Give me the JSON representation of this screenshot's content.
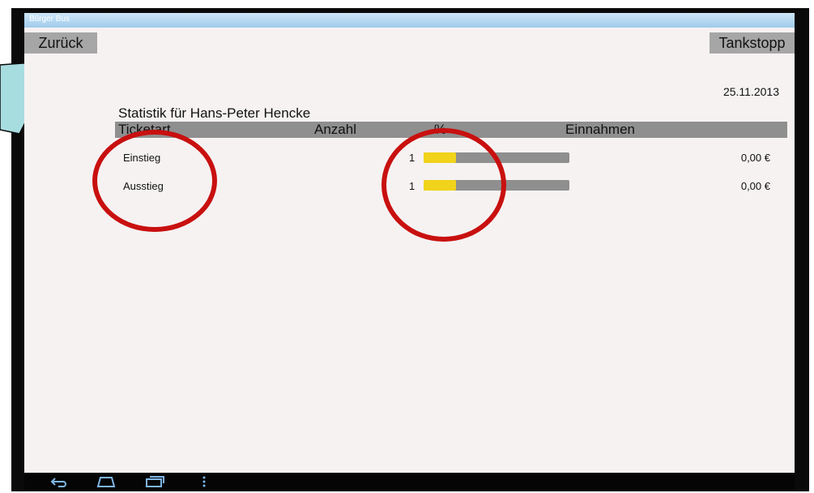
{
  "app": {
    "title": "Bürger Bus"
  },
  "toolbar": {
    "back_label": "Zurück",
    "tankstopp_label": "Tankstopp"
  },
  "date": "25.11.2013",
  "statistics": {
    "title": "Statistik für Hans-Peter Hencke",
    "columns": [
      "Ticketart",
      "Anzahl",
      "%",
      "Einnahmen"
    ],
    "rows": [
      {
        "ticketart": "Einstieg",
        "anzahl": "1",
        "percent": 0.22,
        "einnahmen": "0,00 €"
      },
      {
        "ticketart": "Ausstieg",
        "anzahl": "1",
        "percent": 0.22,
        "einnahmen": "0,00 €"
      }
    ]
  },
  "colors": {
    "bar_fill": "#f0d31a",
    "bar_track": "#8f8f8f",
    "highlight_ring": "#c8100f",
    "callout": "#a8dde0"
  },
  "navbar": {
    "icons": [
      "back-icon",
      "home-icon",
      "recent-apps-icon",
      "menu-icon"
    ]
  }
}
